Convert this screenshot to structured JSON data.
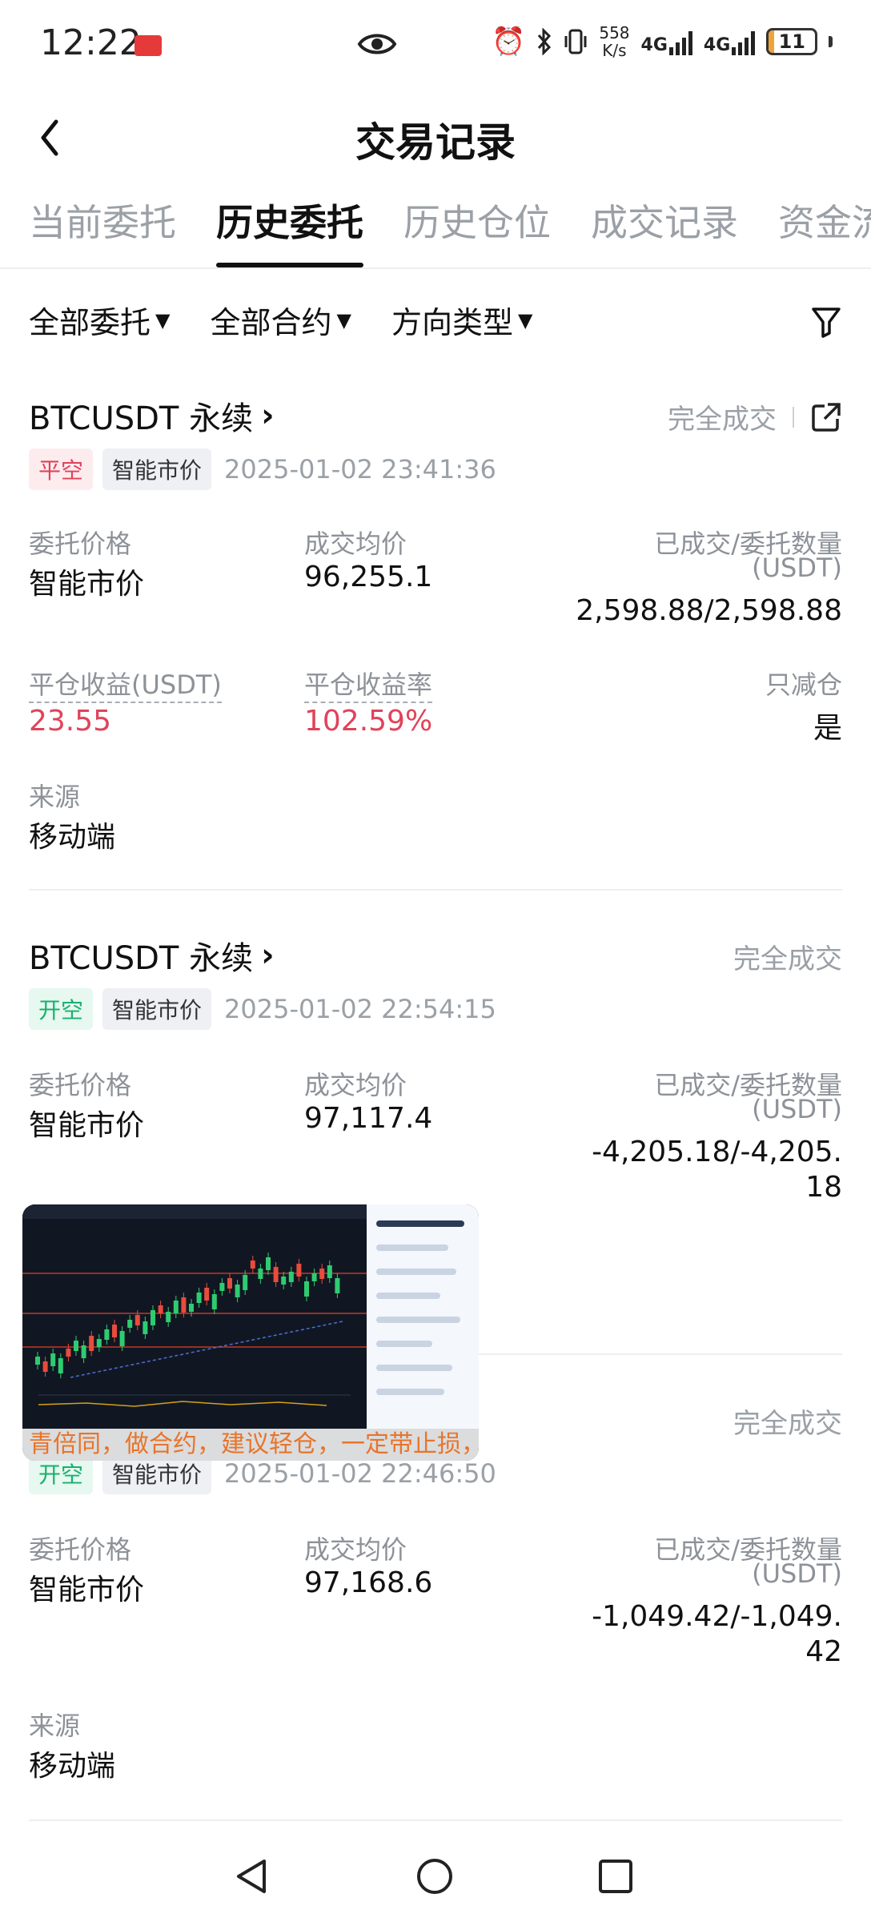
{
  "status_bar": {
    "time": "12:22",
    "speed_top": "558",
    "speed_bottom": "K/s",
    "net1": "4G",
    "net2": "4G",
    "battery": "11",
    "battery_level": 0.11
  },
  "header": {
    "title": "交易记录"
  },
  "tabs": [
    {
      "label": "当前委托",
      "active": false
    },
    {
      "label": "历史委托",
      "active": true
    },
    {
      "label": "历史仓位",
      "active": false
    },
    {
      "label": "成交记录",
      "active": false
    },
    {
      "label": "资金流",
      "active": false
    }
  ],
  "filters": [
    {
      "label": "全部委托"
    },
    {
      "label": "全部合约"
    },
    {
      "label": "方向类型"
    }
  ],
  "orders": [
    {
      "symbol": "BTCUSDT 永续",
      "status": "完全成交",
      "side": "平空",
      "order_type": "智能市价",
      "time": "2025-01-02 23:41:36",
      "price_label": "委托价格",
      "price": "智能市价",
      "avg_label": "成交均价",
      "avg": "96,255.1",
      "qty_label": "已成交/委托数量",
      "qty_unit": "(USDT)",
      "qty": "2,598.88/2,598.88",
      "pnl_label": "平仓收益(USDT)",
      "pnl": "23.55",
      "pnl_rate_label": "平仓收益率",
      "pnl_rate": "102.59%",
      "reduce_label": "只减仓",
      "reduce": "是",
      "source_label": "来源",
      "source": "移动端"
    },
    {
      "symbol": "BTCUSDT 永续",
      "status": "完全成交",
      "side": "开空",
      "order_type": "智能市价",
      "time": "2025-01-02 22:54:15",
      "price_label": "委托价格",
      "price": "智能市价",
      "avg_label": "成交均价",
      "avg": "97,117.4",
      "qty_label": "已成交/委托数量",
      "qty_unit": "(USDT)",
      "qty_line1": "-4,205.18/-4,205.",
      "qty_line2": "18"
    },
    {
      "status": "完全成交",
      "side": "开空",
      "order_type": "智能市价",
      "time": "2025-01-02 22:46:50",
      "price_label": "委托价格",
      "price": "智能市价",
      "avg_label": "成交均价",
      "avg": "97,168.6",
      "qty_label": "已成交/委托数量",
      "qty_unit": "(USDT)",
      "qty_line1": "-1,049.42/-1,049.",
      "qty_line2": "42",
      "source_label": "来源",
      "source": "移动端"
    }
  ],
  "video_overlay": {
    "caption": "青倍同，做合约，建议轻仓，一定带止损，不扛单"
  },
  "colors": {
    "accent_red": "#e0435a",
    "accent_green": "#19b06f",
    "muted": "#8d9298"
  }
}
